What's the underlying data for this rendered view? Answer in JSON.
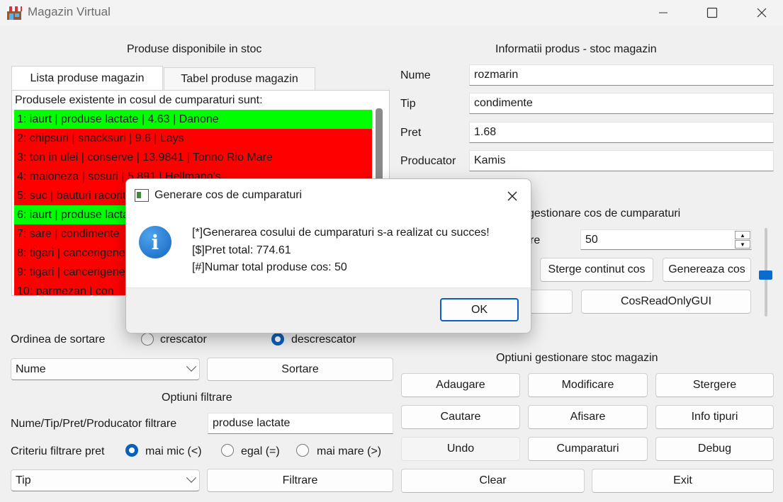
{
  "window": {
    "title": "Magazin Virtual"
  },
  "left": {
    "heading": "Produse disponibile in stoc",
    "tabs": [
      "Lista produse magazin",
      "Tabel produse magazin"
    ],
    "list": {
      "header": "Produsele existente in cosul de cumparaturi sunt:",
      "rows": [
        {
          "text": "1: iaurt | produse lactate | 4.63 | Danone",
          "color": "green"
        },
        {
          "text": "2: chipsuri | snacksuri | 9.6 | Lays",
          "color": "red"
        },
        {
          "text": "3: ton in ulei | conserve | 13.9841 | Tonno Rio Mare",
          "color": "red"
        },
        {
          "text": "4: maioneza | sosuri | 5.891 | Hellmann's",
          "color": "red"
        },
        {
          "text": "5: suc | bauturi racoritoare",
          "color": "red"
        },
        {
          "text": "6: iaurt | produse lactate",
          "color": "green"
        },
        {
          "text": "7: sare | condimente",
          "color": "red"
        },
        {
          "text": "8: tigari | cancerigene",
          "color": "red"
        },
        {
          "text": "9: tigari | cancerigene",
          "color": "red"
        },
        {
          "text": "10: parmezan | con",
          "color": "red"
        }
      ]
    },
    "sort": {
      "label": "Ordinea de sortare",
      "asc": "crescator",
      "desc": "descrescator",
      "combo": "Nume",
      "button": "Sortare"
    },
    "filter": {
      "heading": "Optiuni filtrare",
      "label": "Nume/Tip/Pret/Producator filtrare",
      "value": "produse lactate",
      "price_label": "Criteriu filtrare pret",
      "opt_lt": "mai mic (<)",
      "opt_eq": "egal (=)",
      "opt_gt": "mai mare (>)",
      "combo": "Tip",
      "button": "Filtrare"
    }
  },
  "right": {
    "heading": "Informatii produs - stoc magazin",
    "fields": [
      {
        "label": "Nume",
        "value": "rozmarin"
      },
      {
        "label": "Tip",
        "value": "condimente"
      },
      {
        "label": "Pret",
        "value": "1.68"
      },
      {
        "label": "Producator",
        "value": "Kamis"
      }
    ],
    "cart": {
      "heading_partial": "gestionare cos de cumparaturi",
      "qty_label_partial": "re",
      "qty_value": "50",
      "btn_clear": "Sterge continut cos",
      "btn_generate": "Genereaza cos",
      "btn_readonly": "CosReadOnlyGUI"
    },
    "stock": {
      "heading": "Optiuni gestionare stoc magazin",
      "buttons": [
        "Adaugare",
        "Modificare",
        "Stergere",
        "Cautare",
        "Afisare",
        "Info tipuri",
        "Undo",
        "Cumparaturi",
        "Debug"
      ],
      "clear": "Clear",
      "exit": "Exit"
    }
  },
  "dialog": {
    "title": "Generare cos de cumparaturi",
    "lines": [
      "[*]Generarea cosului de cumparaturi s-a realizat cu succes!",
      "[$]Pret total: 774.61",
      "[#]Numar total produse cos: 50"
    ],
    "ok": "OK"
  },
  "colors": {
    "green_row": "#00ff00",
    "red_row": "#ff0000",
    "accent": "#0a5fbd"
  }
}
